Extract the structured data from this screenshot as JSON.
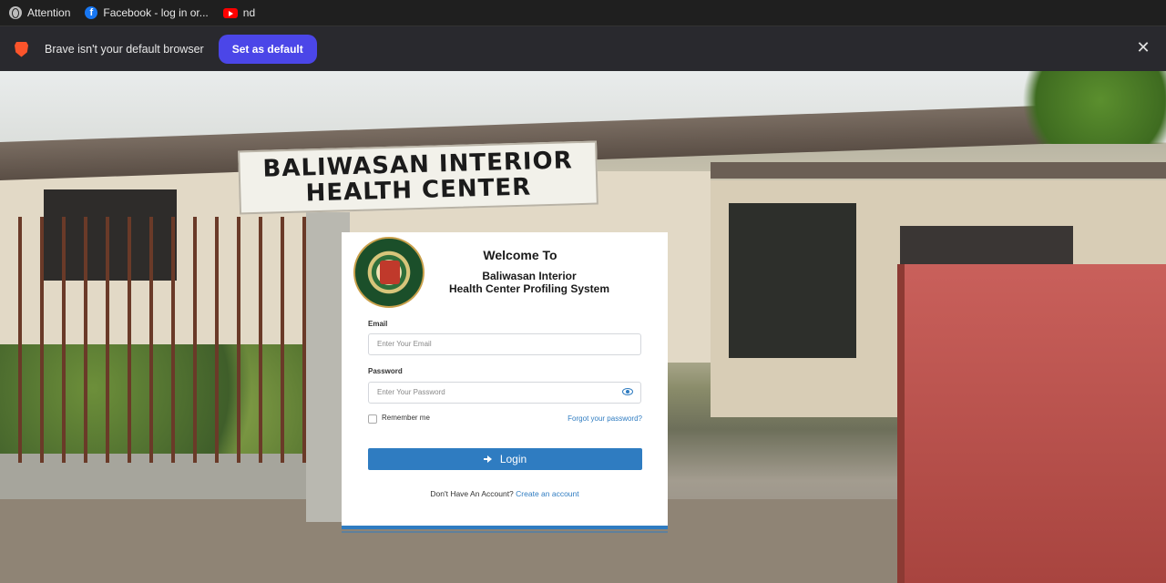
{
  "bookmarks": [
    {
      "label": "Attention",
      "icon": "globe-icon"
    },
    {
      "label": "Facebook - log in or...",
      "icon": "facebook-icon"
    },
    {
      "label": "nd",
      "icon": "youtube-icon"
    }
  ],
  "infobar": {
    "message": "Brave isn't your default browser",
    "button": "Set as default",
    "close": "✕"
  },
  "photo": {
    "sign_line1": "BALIWASAN INTERIOR",
    "sign_line2": "HEALTH CENTER"
  },
  "login": {
    "welcome": "Welcome To",
    "subtitle_line1": "Baliwasan Interior",
    "subtitle_line2": "Health Center Profiling System",
    "email_label": "Email",
    "email_placeholder": "Enter Your Email",
    "password_label": "Password",
    "password_placeholder": "Enter Your Password",
    "remember": "Remember me",
    "forgot": "Forgot your password?",
    "button": "Login",
    "no_account": "Don't Have An Account?",
    "create": "Create an account"
  },
  "colors": {
    "accent": "#2f7cc1",
    "brave_button": "#4b46e8",
    "toolbar": "#1f1f1f"
  }
}
